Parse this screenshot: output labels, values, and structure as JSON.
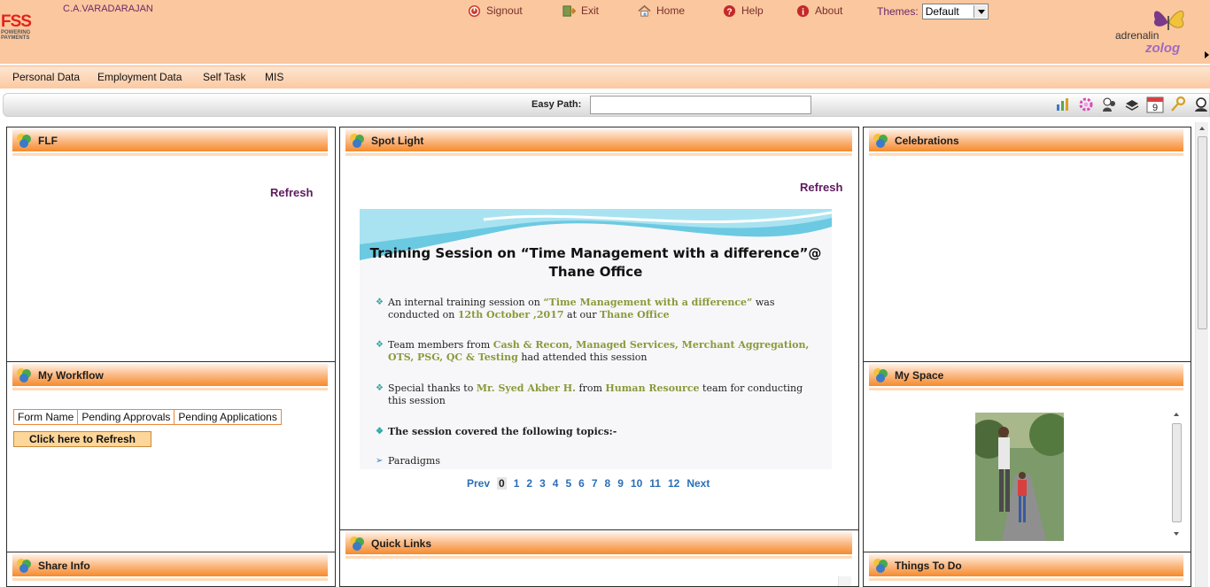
{
  "header": {
    "logo_text": "FSS",
    "logo_tagline": "POWERING PAYMENTS",
    "username": "C.A.VARADARAJAN",
    "nav": [
      {
        "label": "Signout",
        "icon": "signout-icon"
      },
      {
        "label": "Exit",
        "icon": "exit-icon"
      },
      {
        "label": "Home",
        "icon": "home-icon"
      },
      {
        "label": "Help",
        "icon": "help-icon"
      },
      {
        "label": "About",
        "icon": "about-icon"
      }
    ],
    "themes_label": "Themes:",
    "themes_selected": "Default",
    "brand_adrenalin": "adrenalin",
    "brand_zolog": "zolog"
  },
  "menu": [
    "Personal Data",
    "Employment Data",
    "Self Task",
    "MIS"
  ],
  "easypath": {
    "label": "Easy Path:",
    "value": ""
  },
  "tools": [
    "chart-icon",
    "gear-icon",
    "people-icon",
    "transfer-icon",
    "calendar-icon",
    "key-icon",
    "user-settings-icon"
  ],
  "tools_calendar_day": "9",
  "panels": {
    "flf": {
      "title": "FLF",
      "refresh": "Refresh"
    },
    "workflow": {
      "title": "My Workflow",
      "columns": [
        "Form Name",
        "Pending Approvals",
        "Pending Applications"
      ],
      "button": "Click here to Refresh"
    },
    "shareinfo": {
      "title": "Share Info"
    },
    "spotlight": {
      "title": "Spot Light",
      "refresh": "Refresh",
      "slide": {
        "title_line1": "Training Session on “Time Management with a difference”@",
        "title_line2": "Thane Office",
        "b1_a": "An internal training session on ",
        "b1_b": "“Time Management  with a difference”",
        "b1_c": "  was conducted on ",
        "b1_d": "12th October ,2017",
        "b1_e": " at our ",
        "b1_f": "Thane Office",
        "b2_a": "Team members from ",
        "b2_b": "Cash & Recon, Managed Services, Merchant Aggregation,  OTS, PSG, QC & Testing",
        "b2_c": " had attended this session",
        "b3_a": "Special thanks to ",
        "b3_b": "Mr. Syed Akber H.",
        "b3_c": " from ",
        "b3_d": "Human Resource",
        "b3_e": " team for conducting this session",
        "b4": "The session covered the following topics:-",
        "b5": "Paradigms"
      },
      "pager": {
        "prev": "Prev",
        "pages": [
          "0",
          "1",
          "2",
          "3",
          "4",
          "5",
          "6",
          "7",
          "8",
          "9",
          "10",
          "11",
          "12"
        ],
        "current": "0",
        "next": "Next"
      }
    },
    "quicklinks": {
      "title": "Quick Links"
    },
    "celebrations": {
      "title": "Celebrations"
    },
    "myspace": {
      "title": "My Space"
    },
    "thingstodo": {
      "title": "Things To Do"
    }
  },
  "colors": {
    "header_bg": "#fbc79e",
    "panel_header": "#f68a2b",
    "refresh": "#5e1a5e",
    "pager_link": "#2b6fb5"
  }
}
